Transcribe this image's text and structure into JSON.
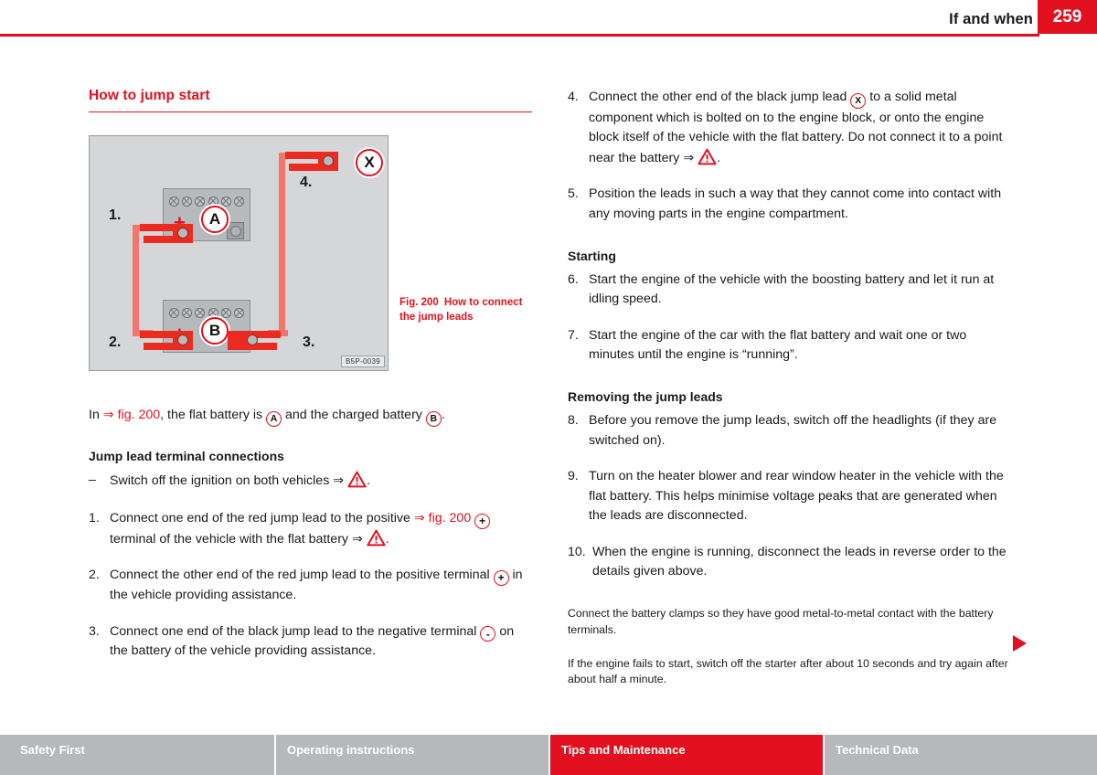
{
  "header": {
    "title": "If and when",
    "page_number": "259",
    "accent_color": "#e2101e"
  },
  "left_column": {
    "section_title": "How to jump start",
    "figure": {
      "labels": [
        "1.",
        "2.",
        "3.",
        "4."
      ],
      "battery_a_marker": "A",
      "battery_b_marker": "B",
      "ground_marker": "X",
      "terminal_plus": "+",
      "terminal_minus": "–",
      "watermark": "B5P-0039",
      "caption_number": "Fig. 200",
      "caption_text": "How to connect the jump leads"
    },
    "intro": {
      "prefix": "In ",
      "ref": "⇒ fig. 200",
      "middle_1": ", the flat battery is ",
      "marker_a": "A",
      "middle_2": " and the charged battery ",
      "marker_b": "B",
      "suffix": "."
    },
    "subheading": "Jump lead terminal connections",
    "dash_item": {
      "marker": "–",
      "text": "Switch off the ignition on both vehicles ⇒ ",
      "suffix": "."
    },
    "steps": [
      {
        "marker": "1.",
        "part1": "Connect one end of the red jump lead to the positive ",
        "ref": "⇒ fig. 200",
        "sign": "+",
        "part2": " terminal of the vehicle with the flat battery ⇒ ",
        "suffix": "."
      },
      {
        "marker": "2.",
        "part1": "Connect the other end of the red jump lead to the positive terminal ",
        "sign": "+",
        "part2": " in the vehicle providing assistance.",
        "suffix": ""
      },
      {
        "marker": "3.",
        "part1": "Connect one end of the black jump lead to the negative terminal ",
        "sign": "-",
        "part2": " on the battery of the vehicle providing assistance.",
        "suffix": ""
      }
    ]
  },
  "right_column": {
    "step4": {
      "marker": "4.",
      "part1": "Connect the other end of the black jump lead ",
      "marker_x": "X",
      "part2": " to a solid metal component which is bolted on to the engine block, or onto the engine block itself of the vehicle with the flat battery. Do not connect it to a point near the battery ⇒ ",
      "suffix": "."
    },
    "step5": {
      "marker": "5.",
      "text": "Position the leads in such a way that they cannot come into contact with any moving parts in the engine compartment."
    },
    "starting_heading": "Starting",
    "starting_steps": [
      {
        "marker": "6.",
        "text": "Start the engine of the vehicle with the boosting battery and let it run at idling speed."
      },
      {
        "marker": "7.",
        "text": "Start the engine of the car with the flat battery and wait one or two minutes until the engine is “running”."
      }
    ],
    "removing_heading": "Removing the jump leads",
    "removing_steps": [
      {
        "marker": "8.",
        "text": "Before you remove the jump leads, switch off the headlights (if they are switched on)."
      },
      {
        "marker": "9.",
        "text": "Turn on the heater blower and rear window heater in the vehicle with the flat battery. This helps minimise voltage peaks that are generated when the leads are disconnected."
      },
      {
        "marker": "10.",
        "text": "When the engine is running, disconnect the leads in reverse order to the details given above."
      }
    ],
    "notes": [
      "Connect the battery clamps so they have good metal-to-metal contact with the battery terminals.",
      "If the engine fails to start, switch off the starter after about 10 seconds and try again after about half a minute."
    ]
  },
  "footer": {
    "tabs": [
      {
        "label": "Safety First",
        "active": false
      },
      {
        "label": "Operating instructions",
        "active": false
      },
      {
        "label": "Tips and Maintenance",
        "active": true
      },
      {
        "label": "Technical Data",
        "active": false
      }
    ]
  }
}
